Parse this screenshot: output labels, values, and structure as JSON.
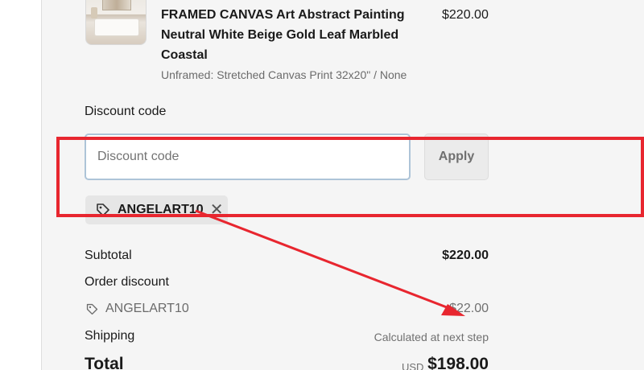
{
  "product": {
    "title": "FRAMED CANVAS Art Abstract Painting Neutral White Beige Gold Leaf Marbled Coastal",
    "variant": "Unframed: Stretched Canvas Print 32x20\" / None",
    "price": "$220.00",
    "thumbnail_icon": "product-image"
  },
  "discount": {
    "section_label": "Discount code",
    "input_placeholder": "Discount code",
    "input_value": "",
    "apply_label": "Apply",
    "applied_code": "ANGELART10",
    "remove_glyph": "✕"
  },
  "summary": {
    "subtotal_label": "Subtotal",
    "subtotal_value": "$220.00",
    "order_discount_label": "Order discount",
    "discount_code": "ANGELART10",
    "discount_value": "-$22.00",
    "shipping_label": "Shipping",
    "shipping_value": "Calculated at next step",
    "total_label": "Total",
    "total_currency": "USD",
    "total_value": "$198.00"
  },
  "annotation": {
    "highlight_color": "#e8262f"
  }
}
